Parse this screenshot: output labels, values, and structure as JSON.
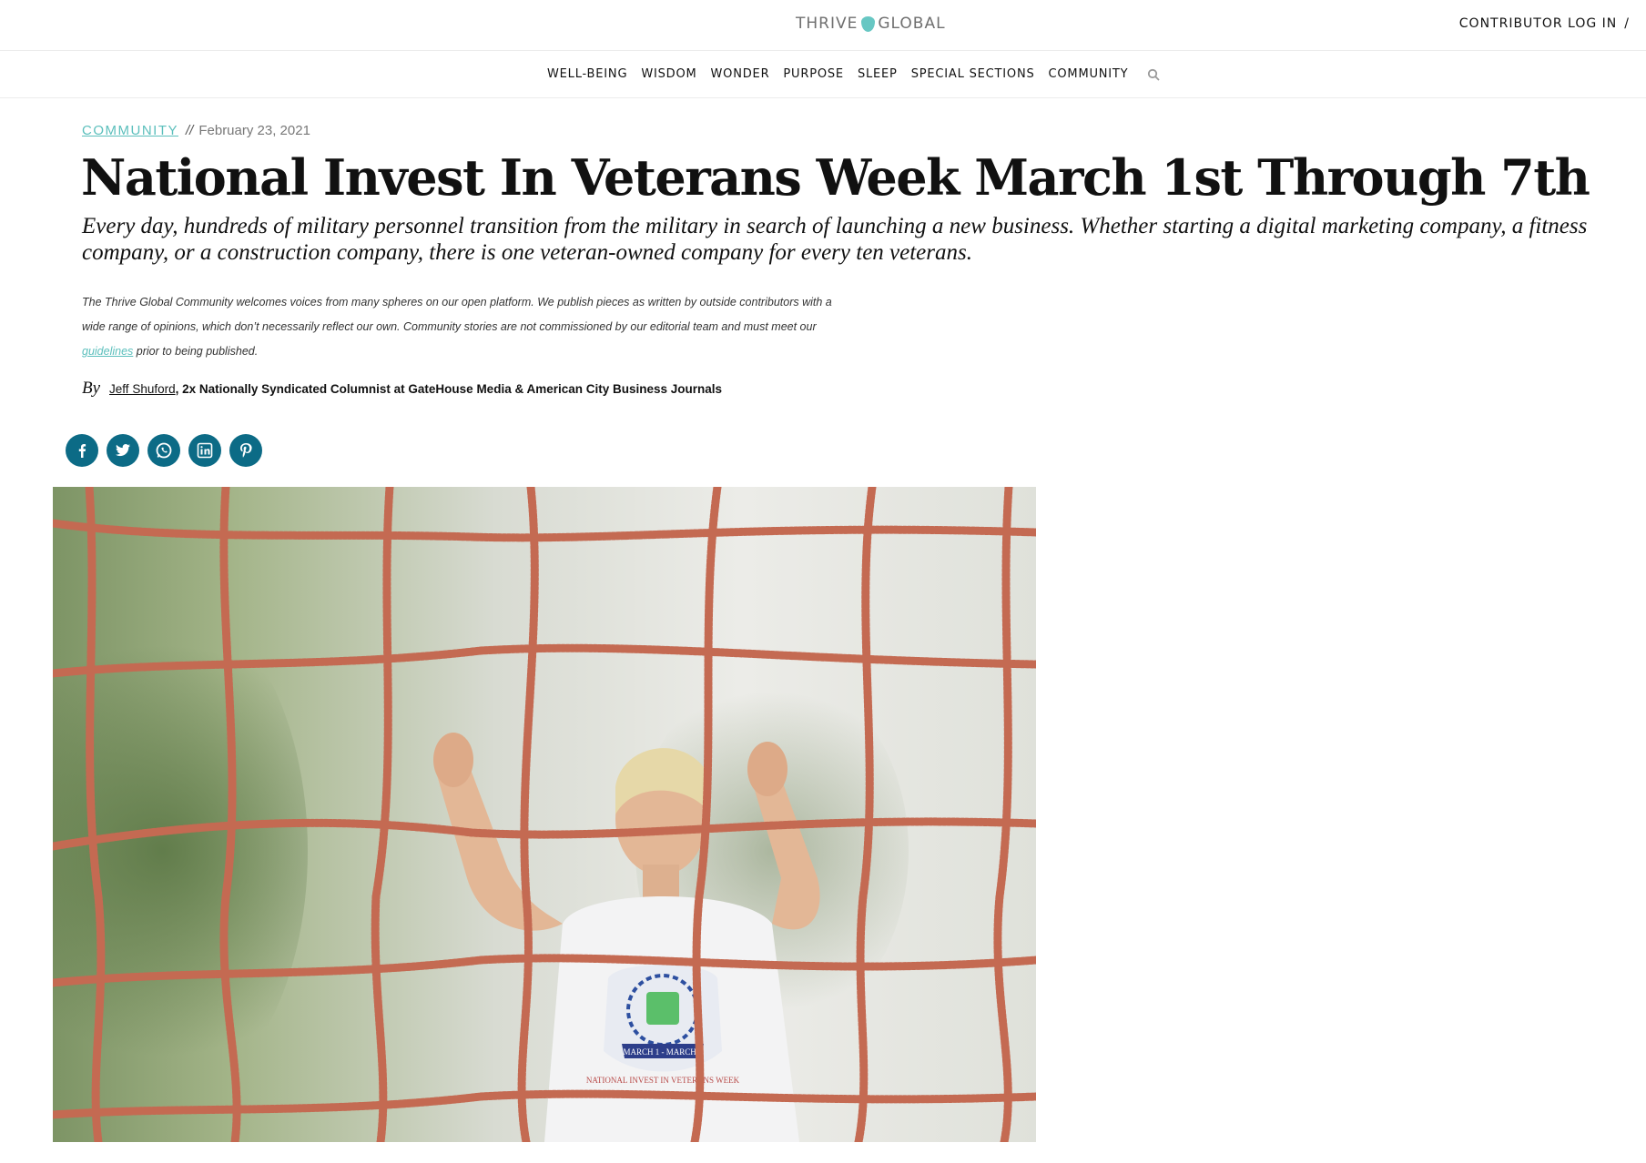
{
  "header": {
    "logo": {
      "left": "THRIVE",
      "right": "GLOBAL",
      "icon": "leaf-icon"
    },
    "login": "CONTRIBUTOR LOG IN",
    "login_sep": "/"
  },
  "nav": {
    "items": [
      "WELL-BEING",
      "WISDOM",
      "WONDER",
      "PURPOSE",
      "SLEEP",
      "SPECIAL SECTIONS",
      "COMMUNITY"
    ],
    "search_icon": "search-icon"
  },
  "article": {
    "category": "COMMUNITY",
    "separator": "//",
    "date": "February 23, 2021",
    "title": "National Invest In Veterans Week March 1st Through 7th",
    "dek": "Every day, hundreds of military personnel transition from the military in search of launching a new business. Whether starting a digital marketing company, a fitness company, or a construction company, there is one veteran-owned company for every ten veterans.",
    "disclaimer": {
      "before": "The Thrive Global Community welcomes voices from many spheres on our open platform. We publish pieces as written by outside contributors with a wide range of opinions, which don’t necessarily reflect our own. Community stories are not commissioned by our editorial team and must meet our ",
      "link": "guidelines",
      "after": " prior to being published."
    },
    "byline": {
      "by": "By",
      "author": "Jeff Shuford",
      "role": ", 2x Nationally Syndicated Columnist at GateHouse Media & American City Business Journals"
    },
    "share": [
      {
        "name": "facebook-share-button",
        "glyph": "f"
      },
      {
        "name": "twitter-share-button",
        "glyph": "t"
      },
      {
        "name": "whatsapp-share-button",
        "glyph": "w"
      },
      {
        "name": "linkedin-share-button",
        "glyph": "in"
      },
      {
        "name": "pinterest-share-button",
        "glyph": "p"
      }
    ],
    "hero_caption": {
      "shirt_text_top": "MARCH 1 - MARCH 7",
      "shirt_text_bottom": "NATIONAL INVEST IN VETERANS WEEK"
    }
  },
  "colors": {
    "accent": "#5bbfbc",
    "share_button": "#0c6b86",
    "rope": "#c46a52"
  }
}
